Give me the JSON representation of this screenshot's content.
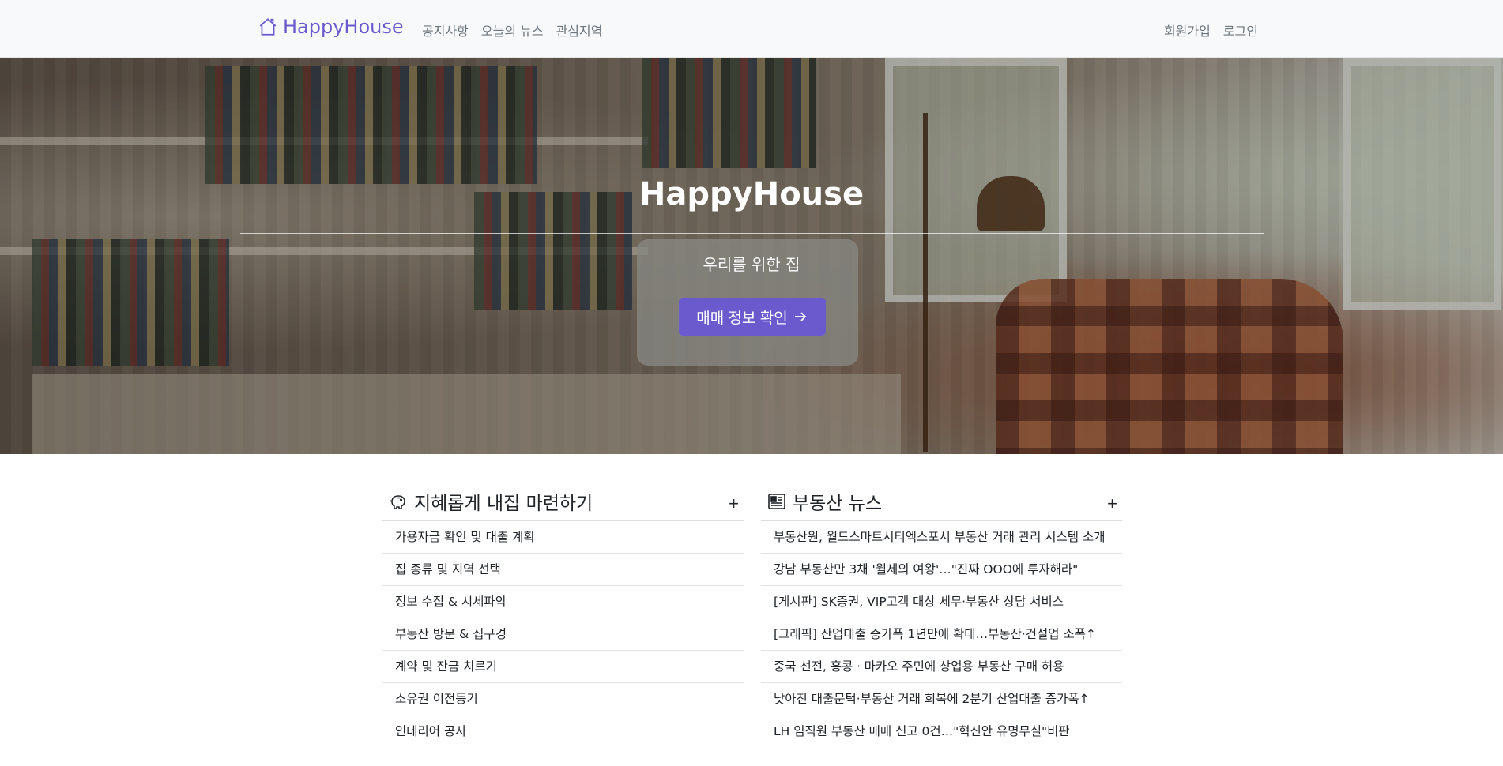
{
  "navbar": {
    "brand": "HappyHouse",
    "links": [
      "공지사항",
      "오늘의 뉴스",
      "관심지역"
    ],
    "right_links": [
      "회원가입",
      "로그인"
    ]
  },
  "hero": {
    "title": "HappyHouse",
    "subtitle": "우리를 위한 집",
    "button_label": "매매 정보 확인"
  },
  "sections": {
    "left": {
      "title": "지혜롭게 내집 마련하기",
      "more": "+",
      "items": [
        "가용자금 확인 및 대출 계획",
        "집 종류 및 지역 선택",
        "정보 수집 & 시세파악",
        "부동산 방문 & 집구경",
        "계약 및 잔금 치르기",
        "소유권 이전등기",
        "인테리어 공사"
      ]
    },
    "right": {
      "title": "부동산 뉴스",
      "more": "+",
      "items": [
        "부동산원, 월드스마트시티엑스포서 부동산 거래 관리 시스템 소개",
        "강남 부동산만 3채 '월세의 여왕'…\"진짜 OOO에 투자해라\"",
        "[게시판] SK증권, VIP고객 대상 세무·부동산 상담 서비스",
        "[그래픽] 산업대출 증가폭 1년만에 확대…부동산·건설업 소폭↑",
        "중국 선전, 홍콩ㆍ마카오 주민에 상업용 부동산 구매 허용",
        "낮아진 대출문턱·부동산 거래 회복에 2분기 산업대출 증가폭↑",
        "LH 임직원 부동산 매매 신고 0건…\"혁신안 유명무실\"비판"
      ]
    }
  },
  "colors": {
    "accent": "#6a5acd",
    "navbar_bg": "#f8f9fa"
  }
}
